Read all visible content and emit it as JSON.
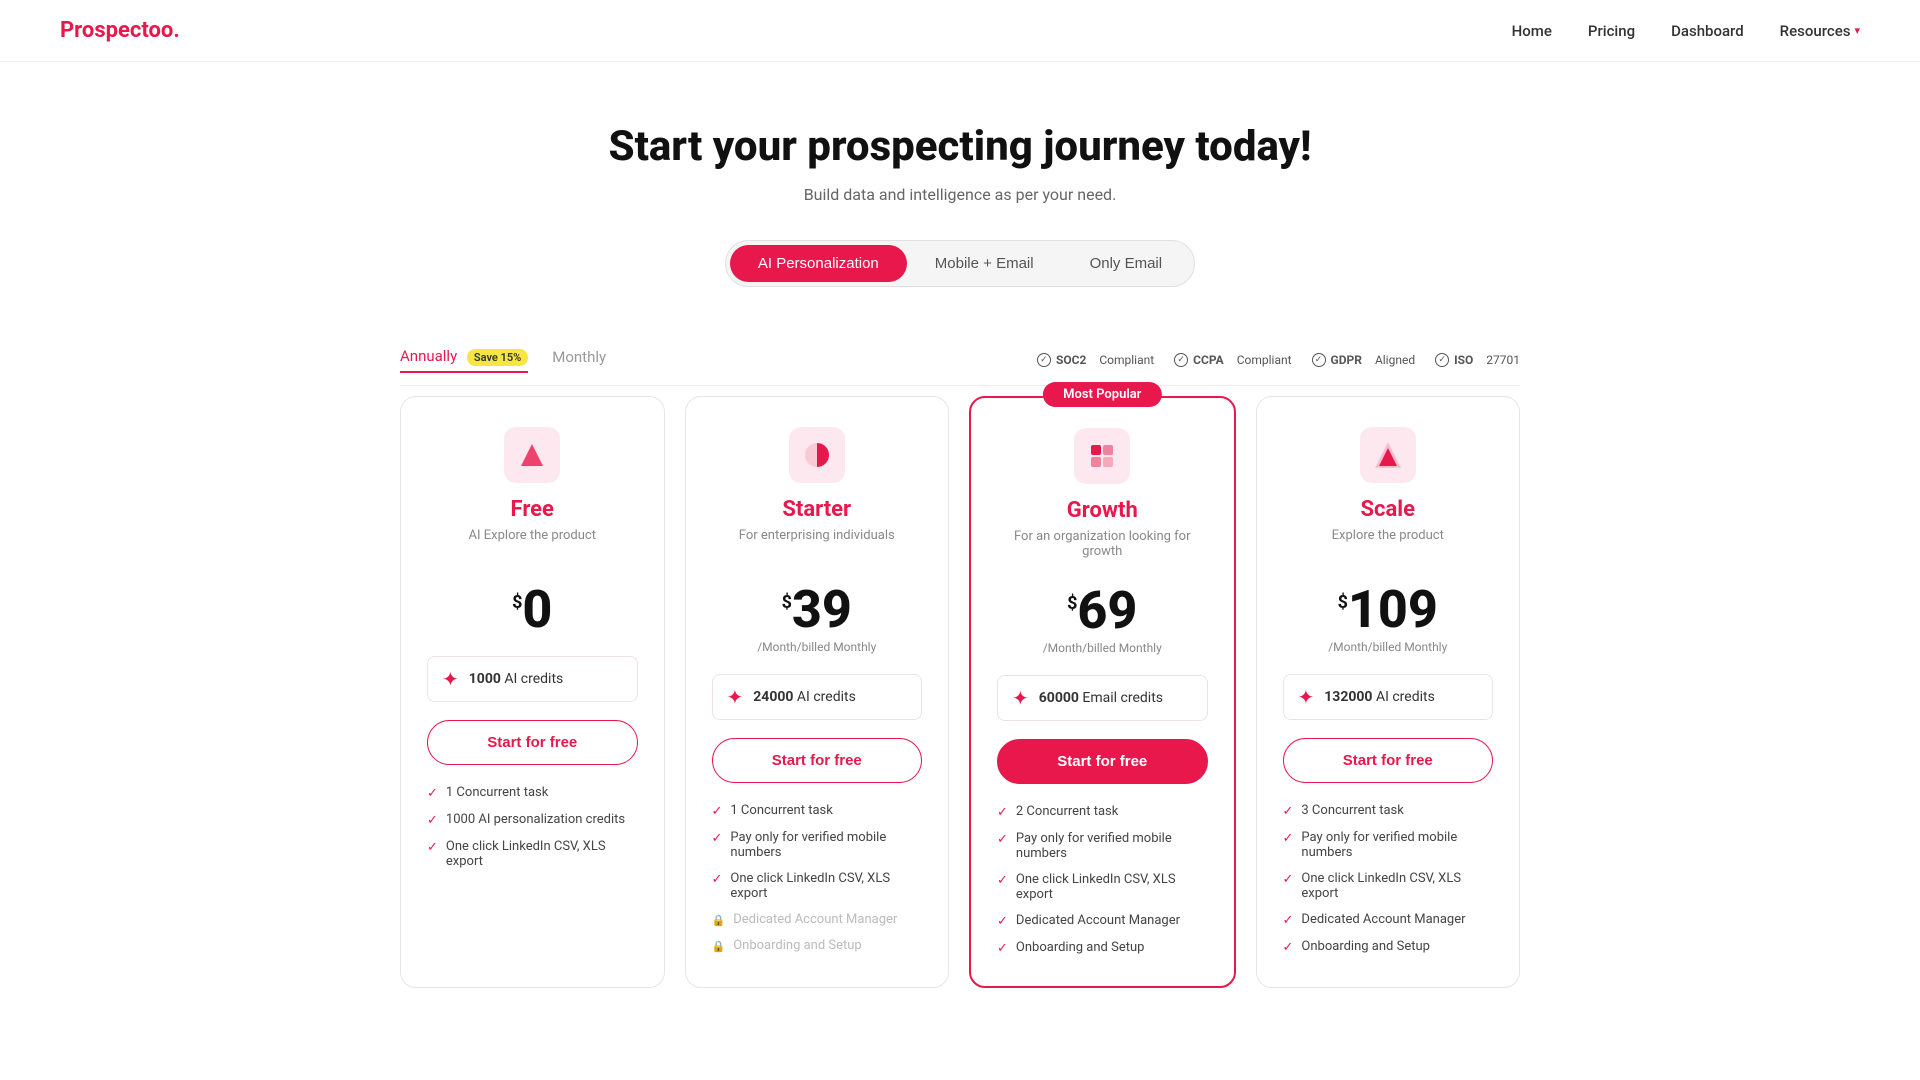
{
  "logo": {
    "text": "Prospectoo",
    "dot": "."
  },
  "nav": {
    "links": [
      {
        "label": "Home",
        "id": "home"
      },
      {
        "label": "Pricing",
        "id": "pricing"
      },
      {
        "label": "Dashboard",
        "id": "dashboard"
      },
      {
        "label": "Resources",
        "id": "resources",
        "has_dropdown": true
      }
    ]
  },
  "hero": {
    "title": "Start your prospecting journey today!",
    "subtitle": "Build data and intelligence as per your need."
  },
  "product_tabs": [
    {
      "label": "AI Personalization",
      "active": true
    },
    {
      "label": "Mobile + Email",
      "active": false
    },
    {
      "label": "Only Email",
      "active": false
    }
  ],
  "billing": {
    "annually_label": "Annually",
    "annually_save_badge": "Save 15%",
    "monthly_label": "Monthly",
    "active": "annually"
  },
  "compliance": [
    {
      "label": "SOC2",
      "suffix": "Compliant"
    },
    {
      "label": "CCPA",
      "suffix": "Compliant"
    },
    {
      "label": "GDPR",
      "suffix": "Aligned"
    },
    {
      "label": "ISO",
      "suffix": "27701"
    }
  ],
  "most_popular_label": "Most Popular",
  "plans": [
    {
      "id": "free",
      "name": "Free",
      "desc": "AI Explore the product",
      "price": "0",
      "price_period": "",
      "credits_amount": "1000",
      "credits_type": "AI credits",
      "cta": "Start for free",
      "cta_style": "outline",
      "popular": false,
      "features": [
        {
          "text": "1 Concurrent task",
          "enabled": true,
          "lock": false
        },
        {
          "text": "1000 AI personalization credits",
          "enabled": true,
          "lock": false
        },
        {
          "text": "One click LinkedIn CSV, XLS export",
          "enabled": true,
          "lock": false
        }
      ]
    },
    {
      "id": "starter",
      "name": "Starter",
      "desc": "For enterprising individuals",
      "price": "39",
      "price_period": "/Month/billed Monthly",
      "credits_amount": "24000",
      "credits_type": "AI credits",
      "cta": "Start for free",
      "cta_style": "outline",
      "popular": false,
      "features": [
        {
          "text": "1 Concurrent task",
          "enabled": true,
          "lock": false
        },
        {
          "text": "Pay only for verified mobile numbers",
          "enabled": true,
          "lock": false
        },
        {
          "text": "One click LinkedIn CSV, XLS export",
          "enabled": true,
          "lock": false
        },
        {
          "text": "Dedicated Account Manager",
          "enabled": false,
          "lock": true
        },
        {
          "text": "Onboarding and Setup",
          "enabled": false,
          "lock": true
        }
      ]
    },
    {
      "id": "growth",
      "name": "Growth",
      "desc": "For an organization looking for growth",
      "price": "69",
      "price_period": "/Month/billed Monthly",
      "credits_amount": "60000",
      "credits_type": "Email credits",
      "cta": "Start for free",
      "cta_style": "filled",
      "popular": true,
      "features": [
        {
          "text": "2 Concurrent task",
          "enabled": true,
          "lock": false
        },
        {
          "text": "Pay only for verified mobile numbers",
          "enabled": true,
          "lock": false
        },
        {
          "text": "One click LinkedIn CSV, XLS export",
          "enabled": true,
          "lock": false
        },
        {
          "text": "Dedicated Account Manager",
          "enabled": true,
          "lock": false
        },
        {
          "text": "Onboarding and Setup",
          "enabled": true,
          "lock": false
        }
      ]
    },
    {
      "id": "scale",
      "name": "Scale",
      "desc": "Explore the product",
      "price": "109",
      "price_period": "/Month/billed Monthly",
      "credits_amount": "132000",
      "credits_type": "AI credits",
      "cta": "Start for free",
      "cta_style": "outline",
      "popular": false,
      "features": [
        {
          "text": "3 Concurrent task",
          "enabled": true,
          "lock": false
        },
        {
          "text": "Pay only for verified mobile numbers",
          "enabled": true,
          "lock": false
        },
        {
          "text": "One click LinkedIn CSV, XLS export",
          "enabled": true,
          "lock": false
        },
        {
          "text": "Dedicated Account Manager",
          "enabled": true,
          "lock": false
        },
        {
          "text": "Onboarding and Setup",
          "enabled": true,
          "lock": false
        }
      ]
    }
  ]
}
